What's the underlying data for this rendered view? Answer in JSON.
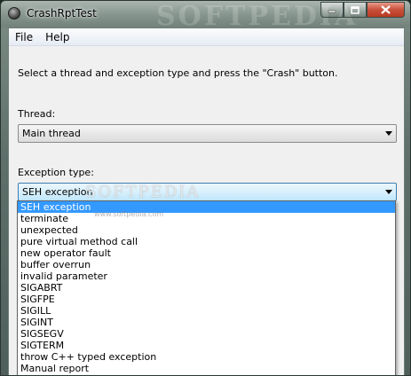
{
  "window": {
    "title": "CrashRptTest",
    "watermark_top": "SOFTPEDIA"
  },
  "menu": {
    "items": [
      "File",
      "Help"
    ]
  },
  "main": {
    "instruction": "Select a thread and exception type and press the \"Crash\" button.",
    "thread_label": "Thread:",
    "thread_value": "Main thread",
    "exception_label": "Exception type:",
    "exception_value": "SEH exception"
  },
  "dropdown": {
    "selected_index": 0,
    "options": [
      "SEH exception",
      "terminate",
      "unexpected",
      "pure virtual method call",
      "new operator fault",
      "buffer overrun",
      "invalid parameter",
      "SIGABRT",
      "SIGFPE",
      "SIGILL",
      "SIGINT",
      "SIGSEGV",
      "SIGTERM",
      "throw C++ typed exception",
      "Manual report"
    ]
  },
  "watermark": {
    "center": "SOFTPEDIA",
    "url": "www.softpedia.com"
  },
  "icons": {
    "app": "app-icon",
    "minimize": "minimize-icon",
    "maximize": "maximize-icon",
    "close": "close-icon",
    "combo_arrow": "chevron-down-icon"
  }
}
